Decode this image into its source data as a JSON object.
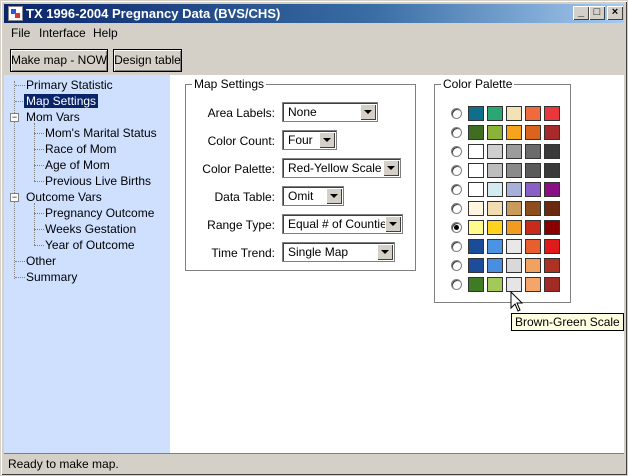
{
  "window": {
    "title": "TX 1996-2004 Pregnancy Data (BVS/CHS)"
  },
  "menu": {
    "items": [
      "File",
      "Interface",
      "Help"
    ]
  },
  "toolbar": {
    "make_map": "Make map - NOW",
    "design_table": "Design table"
  },
  "tree": {
    "primary_statistic": "Primary Statistic",
    "map_settings": "Map Settings",
    "mom_vars": "Mom Vars",
    "moms_marital_status": "Mom's Marital Status",
    "race_of_mom": "Race of Mom",
    "age_of_mom": "Age of Mom",
    "previous_live_births": "Previous Live Births",
    "outcome_vars": "Outcome Vars",
    "pregnancy_outcome": "Pregnancy Outcome",
    "weeks_gestation": "Weeks Gestation",
    "year_of_outcome": "Year of Outcome",
    "other": "Other",
    "summary": "Summary"
  },
  "map_settings": {
    "title": "Map Settings",
    "area_labels": {
      "label": "Area Labels:",
      "value": "None"
    },
    "color_count": {
      "label": "Color Count:",
      "value": "Four"
    },
    "color_palette": {
      "label": "Color Palette:",
      "value": "Red-Yellow Scale"
    },
    "data_table": {
      "label": "Data Table:",
      "value": "Omit"
    },
    "range_type": {
      "label": "Range Type:",
      "value": "Equal # of Counties"
    },
    "time_trend": {
      "label": "Time Trend:",
      "value": "Single Map"
    }
  },
  "color_palette": {
    "title": "Color Palette",
    "selected_index": 6,
    "rows": [
      [
        "#0f6e8c",
        "#2aa775",
        "#f2e2b5",
        "#ef6a3c",
        "#e8383d"
      ],
      [
        "#3f6e23",
        "#8bb33a",
        "#f5a41c",
        "#d9641f",
        "#a8292a"
      ],
      [
        "#ffffff",
        "#cfcfcf",
        "#9c9c9c",
        "#6a6a6a",
        "#3a3a3a"
      ],
      [
        "#ffffff",
        "#bdbdbd",
        "#8a8a8a",
        "#5a5a5a",
        "#3a3a3a"
      ],
      [
        "#ffffff",
        "#d3ecf2",
        "#a7b0d9",
        "#8b5fc8",
        "#8a0f84"
      ],
      [
        "#fff6e2",
        "#f1ddb0",
        "#c89b5a",
        "#8d4d1d",
        "#6a2a0f"
      ],
      [
        "#fffa8c",
        "#ffd21f",
        "#f39a20",
        "#c82a1c",
        "#8a0000"
      ],
      [
        "#1a4c9a",
        "#4a94e3",
        "#e8e8e8",
        "#e85f2f",
        "#e01a1a"
      ],
      [
        "#1e4c9c",
        "#4a8ee0",
        "#d9d9d9",
        "#f2a260",
        "#ad3222"
      ],
      [
        "#3f7a24",
        "#a2c95a",
        "#e5e5e5",
        "#f5a56a",
        "#a12a25"
      ]
    ],
    "tooltip": "Brown-Green Scale"
  },
  "status": {
    "text": "Ready to make map."
  }
}
